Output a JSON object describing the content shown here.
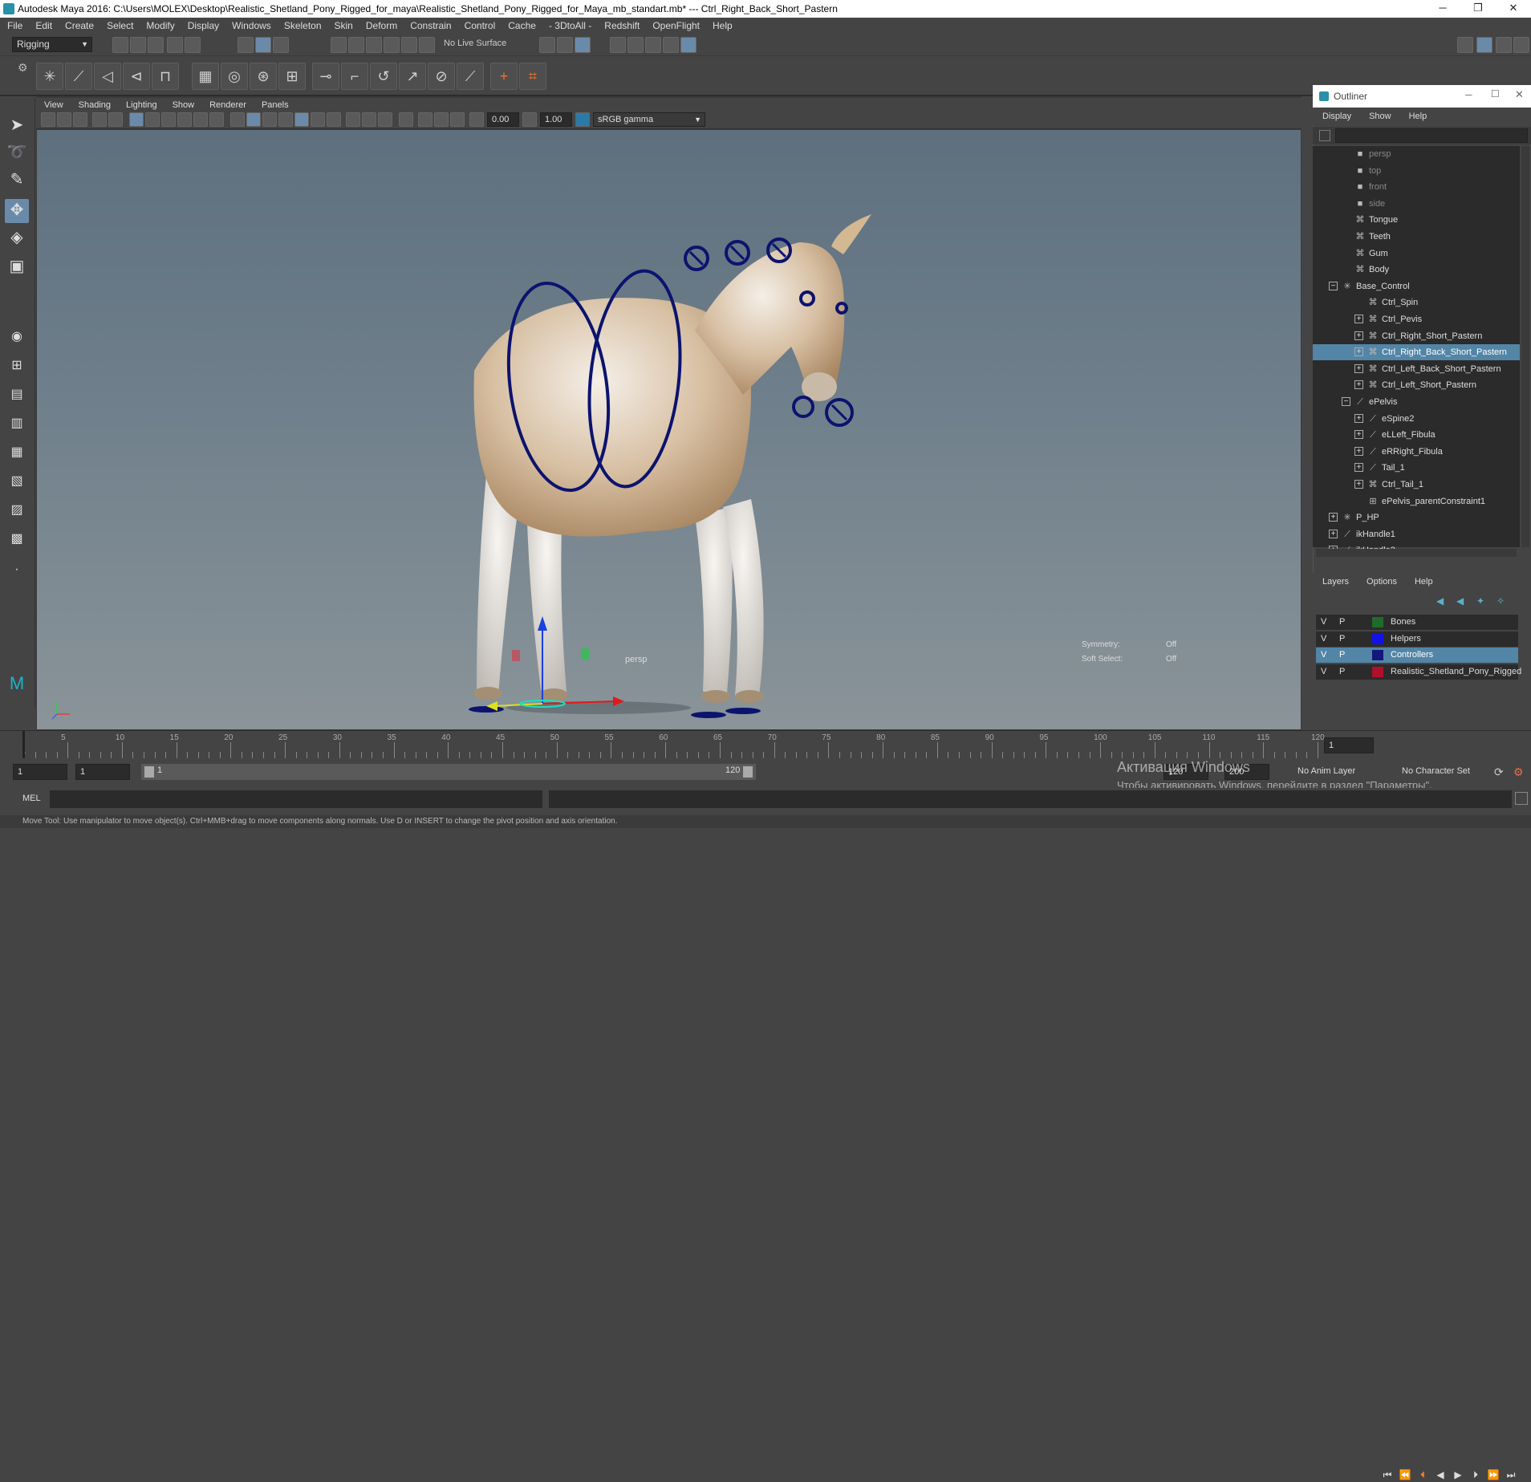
{
  "window": {
    "title": "Autodesk Maya 2016: C:\\Users\\MOLEX\\Desktop\\Realistic_Shetland_Pony_Rigged_for_maya\\Realistic_Shetland_Pony_Rigged_for_Maya_mb_standart.mb*  ---  Ctrl_Right_Back_Short_Pastern"
  },
  "menubar": [
    "File",
    "Edit",
    "Create",
    "Select",
    "Modify",
    "Display",
    "Windows",
    "Skeleton",
    "Skin",
    "Deform",
    "Constrain",
    "Control",
    "Cache",
    "- 3DtoAll -",
    "Redshift",
    "OpenFlight",
    "Help"
  ],
  "statusline": {
    "mode": "Rigging",
    "live_surface": "No Live Surface"
  },
  "viewport": {
    "menu": [
      "View",
      "Shading",
      "Lighting",
      "Show",
      "Renderer",
      "Panels"
    ],
    "exposure": "0.00",
    "gamma": "1.00",
    "color_space": "sRGB gamma",
    "camera_label": "persp",
    "symmetry_label": "Symmetry:",
    "symmetry_value": "Off",
    "soft_select_label": "Soft Select:",
    "soft_select_value": "Off"
  },
  "outliner": {
    "title": "Outliner",
    "menu": [
      "Display",
      "Show",
      "Help"
    ],
    "items": [
      {
        "label": "persp",
        "indent": 2,
        "icon": "camera-icon",
        "expander": "",
        "dim": true
      },
      {
        "label": "top",
        "indent": 2,
        "icon": "camera-icon",
        "expander": "",
        "dim": true
      },
      {
        "label": "front",
        "indent": 2,
        "icon": "camera-icon",
        "expander": "",
        "dim": true
      },
      {
        "label": "side",
        "indent": 2,
        "icon": "camera-icon",
        "expander": "",
        "dim": true
      },
      {
        "label": "Tongue",
        "indent": 2,
        "icon": "mesh-icon",
        "expander": ""
      },
      {
        "label": "Teeth",
        "indent": 2,
        "icon": "mesh-icon",
        "expander": ""
      },
      {
        "label": "Gum",
        "indent": 2,
        "icon": "mesh-icon",
        "expander": ""
      },
      {
        "label": "Body",
        "indent": 2,
        "icon": "mesh-icon",
        "expander": ""
      },
      {
        "label": "Base_Control",
        "indent": 1,
        "icon": "joint-icon",
        "expander": "−",
        "section": true
      },
      {
        "label": "Ctrl_Spin",
        "indent": 3,
        "icon": "curve-icon",
        "expander": ""
      },
      {
        "label": "Ctrl_Pevis",
        "indent": 3,
        "icon": "curve-icon",
        "expander": "+"
      },
      {
        "label": "Ctrl_Right_Short_Pastern",
        "indent": 3,
        "icon": "curve-icon",
        "expander": "+"
      },
      {
        "label": "Ctrl_Right_Back_Short_Pastern",
        "indent": 3,
        "icon": "curve-icon",
        "expander": "+",
        "selected": true
      },
      {
        "label": "Ctrl_Left_Back_Short_Pastern",
        "indent": 3,
        "icon": "curve-icon",
        "expander": "+"
      },
      {
        "label": "Ctrl_Left_Short_Pastern",
        "indent": 3,
        "icon": "curve-icon",
        "expander": "+"
      },
      {
        "label": "ePelvis",
        "indent": 2,
        "icon": "bone-icon",
        "expander": "−"
      },
      {
        "label": "eSpine2",
        "indent": 3,
        "icon": "bone-icon",
        "expander": "+"
      },
      {
        "label": "eLLeft_Fibula",
        "indent": 3,
        "icon": "bone-icon",
        "expander": "+"
      },
      {
        "label": "eRRight_Fibula",
        "indent": 3,
        "icon": "bone-icon",
        "expander": "+"
      },
      {
        "label": "Tail_1",
        "indent": 3,
        "icon": "bone-icon",
        "expander": "+"
      },
      {
        "label": "Ctrl_Tail_1",
        "indent": 3,
        "icon": "curve-icon",
        "expander": "+"
      },
      {
        "label": "ePelvis_parentConstraint1",
        "indent": 3,
        "icon": "constraint-icon",
        "expander": ""
      },
      {
        "label": "P_HP",
        "indent": 1,
        "icon": "joint-icon",
        "expander": "+"
      },
      {
        "label": "ikHandle1",
        "indent": 1,
        "icon": "ik-icon",
        "expander": "+"
      },
      {
        "label": "ikHandle2",
        "indent": 1,
        "icon": "ik-icon",
        "expander": "+"
      }
    ]
  },
  "layers": {
    "menu": [
      "Layers",
      "Options",
      "Help"
    ],
    "rows": [
      {
        "v": "V",
        "p": "P",
        "color": "#1f6b2b",
        "name": "Bones",
        "selected": false
      },
      {
        "v": "V",
        "p": "P",
        "color": "#1212e8",
        "name": "Helpers",
        "selected": false
      },
      {
        "v": "V",
        "p": "P",
        "color": "#11197a",
        "name": "Controllers",
        "selected": true
      },
      {
        "v": "V",
        "p": "P",
        "color": "#b0102a",
        "name": "Realistic_Shetland_Pony_Rigged",
        "selected": false
      }
    ]
  },
  "timeline": {
    "ticks": [
      "1",
      "5",
      "10",
      "15",
      "20",
      "25",
      "30",
      "35",
      "40",
      "45",
      "50",
      "55",
      "60",
      "65",
      "70",
      "75",
      "80",
      "85",
      "90",
      "95",
      "100",
      "105",
      "110",
      "115",
      "120"
    ],
    "current_frame": "1",
    "range_start": "1",
    "range_playback_start": "1",
    "range_slider_start": "1",
    "range_slider_end": "120",
    "range_end_field": "120",
    "range_end_max": "200",
    "anim_layer": "No Anim Layer",
    "character_set": "No Character Set"
  },
  "cmdline": {
    "label": "MEL"
  },
  "helpline": {
    "text": "Move Tool: Use manipulator to move object(s). Ctrl+MMB+drag to move components along normals. Use D or INSERT to change the pivot position and axis orientation."
  },
  "watermark": {
    "line1": "Активация Windows",
    "line2": "Чтобы активировать Windows, перейдите в раздел \"Параметры\"."
  }
}
